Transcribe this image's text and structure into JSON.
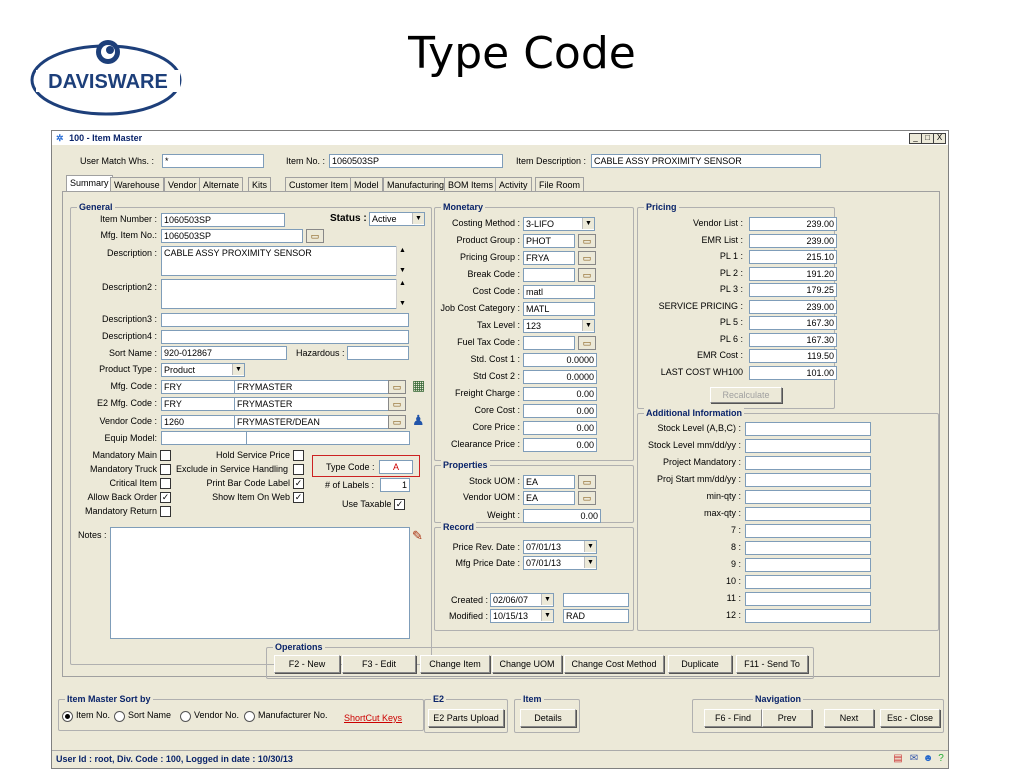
{
  "slide": {
    "title": "Type Code",
    "logo_text": "DAVISWARE"
  },
  "window": {
    "title": "100 - Item Master",
    "controls": [
      "_",
      "□",
      "X"
    ]
  },
  "header": {
    "user_match_label": "User Match Whs. :",
    "user_match_value": "*",
    "item_no_label": "Item No. :",
    "item_no_value": "1060503SP",
    "item_desc_label": "Item Description :",
    "item_desc_value": "CABLE ASSY  PROXIMITY SENSOR"
  },
  "tabs": [
    "Summary",
    "Warehouse",
    "Vendor",
    "Alternate",
    "Kits",
    "Customer Item",
    "Model",
    "Manufacturing",
    "BOM Items",
    "Activity",
    "File Room"
  ],
  "general": {
    "title": "General",
    "item_number_label": "Item Number :",
    "item_number": "1060503SP",
    "status_label": "Status :",
    "status": "Active",
    "mfg_item_label": "Mfg. Item No.:",
    "mfg_item": "1060503SP",
    "description_label": "Description :",
    "description": "CABLE ASSY  PROXIMITY SENSOR",
    "description2_label": "Description2 :",
    "description3_label": "Description3 :",
    "description4_label": "Description4 :",
    "sort_name_label": "Sort Name :",
    "sort_name": "920-012867",
    "hazardous_label": "Hazardous :",
    "product_type_label": "Product Type :",
    "product_type": "Product",
    "mfg_code_label": "Mfg. Code :",
    "mfg_code": "FRY",
    "mfg_name": "FRYMASTER",
    "e2_mfg_label": "E2 Mfg. Code :",
    "e2_mfg_code": "FRY",
    "e2_mfg_name": "FRYMASTER",
    "vendor_code_label": "Vendor Code :",
    "vendor_code": "1260",
    "vendor_name": "FRYMASTER/DEAN",
    "equip_model_label": "Equip Model:",
    "mandatory_main": "Mandatory Main",
    "hold_service_price": "Hold Service Price",
    "mandatory_truck": "Mandatory Truck",
    "exclude_service": "Exclude in Service Handling",
    "critical_item": "Critical Item",
    "print_bar_code": "Print Bar Code Label",
    "allow_back_order": "Allow Back Order",
    "show_item_web": "Show Item On Web",
    "mandatory_return": "Mandatory Return",
    "type_code_label": "Type Code :",
    "type_code": "A",
    "num_labels_label": "# of Labels :",
    "num_labels": "1",
    "use_taxable": "Use Taxable",
    "notes_label": "Notes :"
  },
  "monetary": {
    "title": "Monetary",
    "rows": [
      {
        "label": "Costing Method :",
        "value": "3-LIFO",
        "kind": "select"
      },
      {
        "label": "Product Group :",
        "value": "PHOT",
        "kind": "folder"
      },
      {
        "label": "Pricing Group :",
        "value": "FRYA",
        "kind": "folder"
      },
      {
        "label": "Break Code :",
        "value": "",
        "kind": "folder"
      },
      {
        "label": "Cost Code :",
        "value": "matl",
        "kind": "text"
      },
      {
        "label": "Job Cost Category :",
        "value": "MATL",
        "kind": "text"
      },
      {
        "label": "Tax Level :",
        "value": "123",
        "kind": "select"
      },
      {
        "label": "Fuel Tax Code :",
        "value": "",
        "kind": "folder"
      },
      {
        "label": "Std. Cost 1 :",
        "value": "0.0000",
        "kind": "num"
      },
      {
        "label": "Std Cost 2 :",
        "value": "0.0000",
        "kind": "num"
      },
      {
        "label": "Freight Charge :",
        "value": "0.00",
        "kind": "num"
      },
      {
        "label": "Core Cost :",
        "value": "0.00",
        "kind": "num"
      },
      {
        "label": "Core Price :",
        "value": "0.00",
        "kind": "num"
      },
      {
        "label": "Clearance Price :",
        "value": "0.00",
        "kind": "num"
      }
    ]
  },
  "properties": {
    "title": "Properties",
    "stock_uom_label": "Stock UOM :",
    "stock_uom": "EA",
    "vendor_uom_label": "Vendor UOM :",
    "vendor_uom": "EA",
    "weight_label": "Weight :",
    "weight": "0.00"
  },
  "record": {
    "title": "Record",
    "price_rev_label": "Price Rev. Date :",
    "price_rev": "07/01/13",
    "mfg_price_label": "Mfg Price Date :",
    "mfg_price": "07/01/13",
    "created_label": "Created :",
    "created": "02/06/07",
    "modified_label": "Modified :",
    "modified": "10/15/13",
    "modified_by": "RAD"
  },
  "pricing": {
    "title": "Pricing",
    "rows": [
      {
        "label": "Vendor List :",
        "value": "239.00"
      },
      {
        "label": "EMR List :",
        "value": "239.00"
      },
      {
        "label": "PL 1 :",
        "value": "215.10"
      },
      {
        "label": "PL 2 :",
        "value": "191.20"
      },
      {
        "label": "PL 3 :",
        "value": "179.25"
      },
      {
        "label": "SERVICE PRICING :",
        "value": "239.00"
      },
      {
        "label": "PL 5 :",
        "value": "167.30"
      },
      {
        "label": "PL 6 :",
        "value": "167.30"
      },
      {
        "label": "EMR Cost :",
        "value": "119.50"
      },
      {
        "label": "LAST COST WH100",
        "value": "101.00"
      }
    ],
    "recalculate": "Recalculate"
  },
  "additional": {
    "title": "Additional Information",
    "rows": [
      "Stock Level (A,B,C) :",
      "Stock Level mm/dd/yy :",
      "Project Mandatory :",
      "Proj Start mm/dd/yy :",
      "min-qty :",
      "max-qty :",
      "7 :",
      "8 :",
      "9 :",
      "10 :",
      "11 :",
      "12 :"
    ]
  },
  "operations": {
    "title": "Operations",
    "buttons": [
      "F2 - New",
      "F3 - Edit",
      "Change Item",
      "Change UOM",
      "Change Cost Method",
      "Duplicate",
      "F11 - Send To"
    ]
  },
  "sort_by": {
    "title": "Item Master Sort by",
    "options": [
      "Item No.",
      "Sort Name",
      "Vendor No.",
      "Manufacturer No."
    ],
    "selected": "Item No.",
    "shortcut_keys": "ShortCut Keys"
  },
  "e2": {
    "title": "E2",
    "button": "E2 Parts Upload"
  },
  "item": {
    "title": "Item",
    "button": "Details"
  },
  "navigation": {
    "title": "Navigation",
    "buttons": [
      "F6 - Find",
      "Prev",
      "Next",
      "Esc - Close"
    ]
  },
  "statusbar": {
    "text": "User Id : root, Div. Code : 100, Logged in date : 10/30/13"
  },
  "colors": {
    "title_blue": "#0a246a",
    "highlight_red": "#cc2222",
    "shortcut_red": "#cc0000"
  }
}
